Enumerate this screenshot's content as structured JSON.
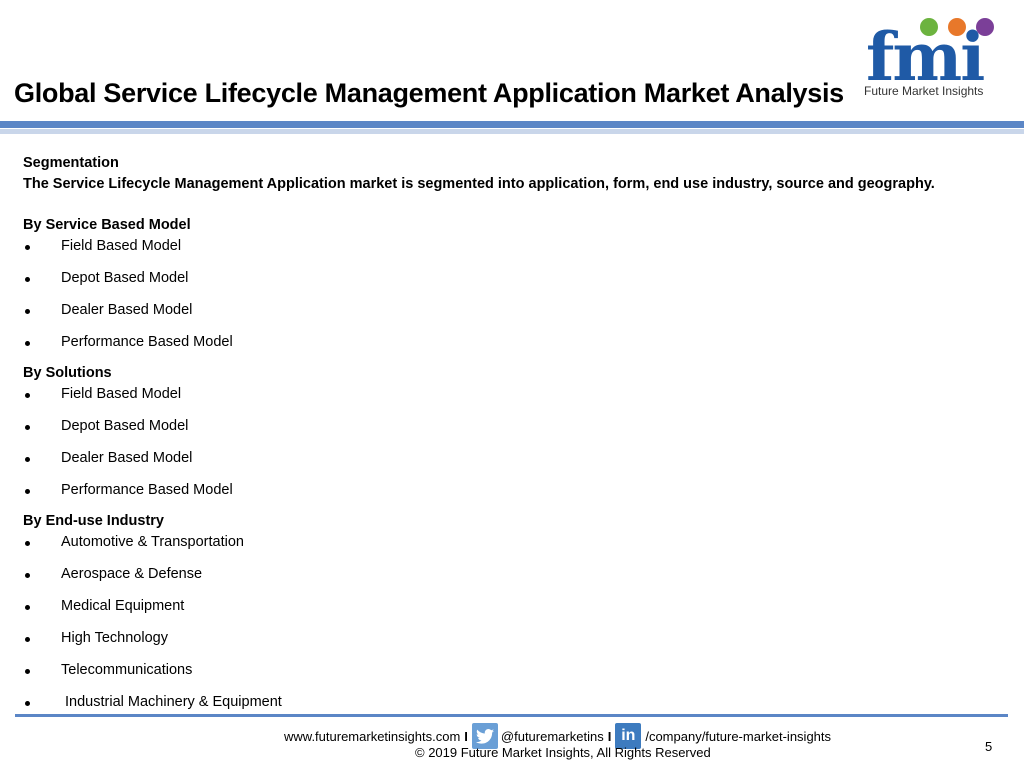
{
  "header": {
    "title": "Global Service Lifecycle Management Application Market Analysis",
    "logo_letters": "fmi",
    "logo_sub": "Future Market Insights",
    "brand_color": "#1f5aa6"
  },
  "content": {
    "section_heading": "Segmentation",
    "intro": "The Service Lifecycle Management Application market is segmented into application, form, end use industry, source and geography.",
    "groups": [
      {
        "heading": "By Service Based Model",
        "items": [
          "Field Based Model",
          "Depot Based Model",
          "Dealer Based Model",
          "Performance Based Model"
        ]
      },
      {
        "heading": "By Solutions",
        "items": [
          "Field Based Model",
          "Depot Based Model",
          "Dealer Based Model",
          "Performance Based Model"
        ]
      },
      {
        "heading": "By End-use Industry",
        "items": [
          "Automotive & Transportation",
          "Aerospace & Defense",
          "Medical Equipment",
          "High Technology",
          "Telecommunications",
          " Industrial Machinery & Equipment"
        ]
      }
    ]
  },
  "footer": {
    "website": "www.futuremarketinsights.com",
    "separator": "I",
    "twitter": "@futuremarketins",
    "linkedin": "/company/future-market-insights",
    "linkedin_icon_text": "in",
    "copyright": "© 2019 Future Market Insights, All Rights Reserved",
    "page_number": "5"
  },
  "icons": [
    "twitter-icon",
    "linkedin-icon"
  ]
}
